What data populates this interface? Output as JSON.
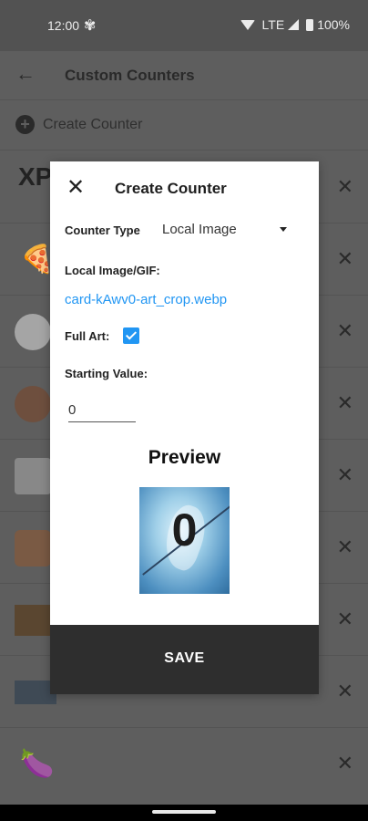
{
  "status": {
    "time": "12:00",
    "network": "LTE",
    "battery": "100%"
  },
  "app": {
    "title": "Custom Counters",
    "create_label": "Create Counter"
  },
  "list": {
    "rows": [
      {
        "kind": "text",
        "label": "XP"
      },
      {
        "kind": "emoji",
        "label": "🍕"
      },
      {
        "kind": "image"
      },
      {
        "kind": "image"
      },
      {
        "kind": "image"
      },
      {
        "kind": "image"
      },
      {
        "kind": "image"
      },
      {
        "kind": "image"
      },
      {
        "kind": "emoji",
        "label": "🍆"
      }
    ],
    "close_glyph": "✕"
  },
  "dialog": {
    "title": "Create Counter",
    "close_glyph": "✕",
    "counter_type_label": "Counter Type",
    "counter_type_value": "Local Image",
    "local_image_label": "Local Image/GIF:",
    "file_name": "card-kAwv0-art_crop.webp",
    "full_art_label": "Full Art:",
    "full_art_checked": true,
    "starting_value_label": "Starting Value:",
    "starting_value": "0",
    "preview_title": "Preview",
    "preview_value": "0",
    "save_label": "SAVE"
  },
  "colors": {
    "accent": "#2196f3",
    "save_bar": "#2e2e2e",
    "scrim": "#5e5e5e"
  }
}
